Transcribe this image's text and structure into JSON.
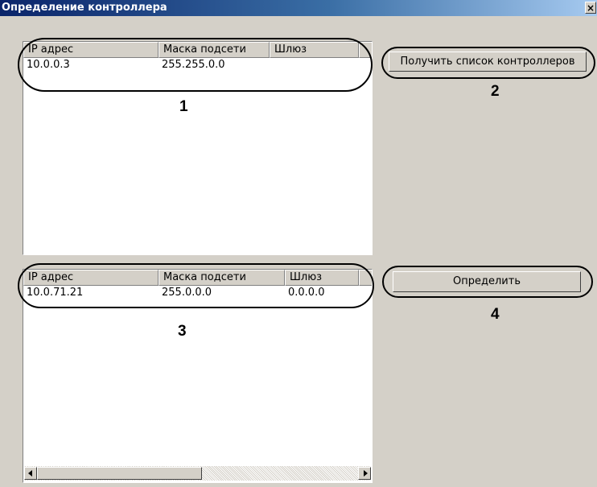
{
  "window": {
    "title": "Определение контроллера",
    "close_glyph": "×"
  },
  "list1": {
    "columns": [
      "IP адрес",
      "Маска подсети",
      "Шлюз"
    ],
    "rows": [
      {
        "ip": "10.0.0.3",
        "mask": "255.255.0.0",
        "gateway": ""
      }
    ]
  },
  "list2": {
    "columns": [
      "IP адрес",
      "Маска подсети",
      "Шлюз"
    ],
    "rows": [
      {
        "ip": "10.0.71.21",
        "mask": "255.0.0.0",
        "gateway": "0.0.0.0"
      }
    ]
  },
  "buttons": {
    "get_list": "Получить список контроллеров",
    "detect": "Определить"
  },
  "callouts": {
    "c1": "1",
    "c2": "2",
    "c3": "3",
    "c4": "4"
  },
  "icons": {
    "close": "close-icon",
    "scroll_left": "arrow-left-icon",
    "scroll_right": "arrow-right-icon"
  }
}
